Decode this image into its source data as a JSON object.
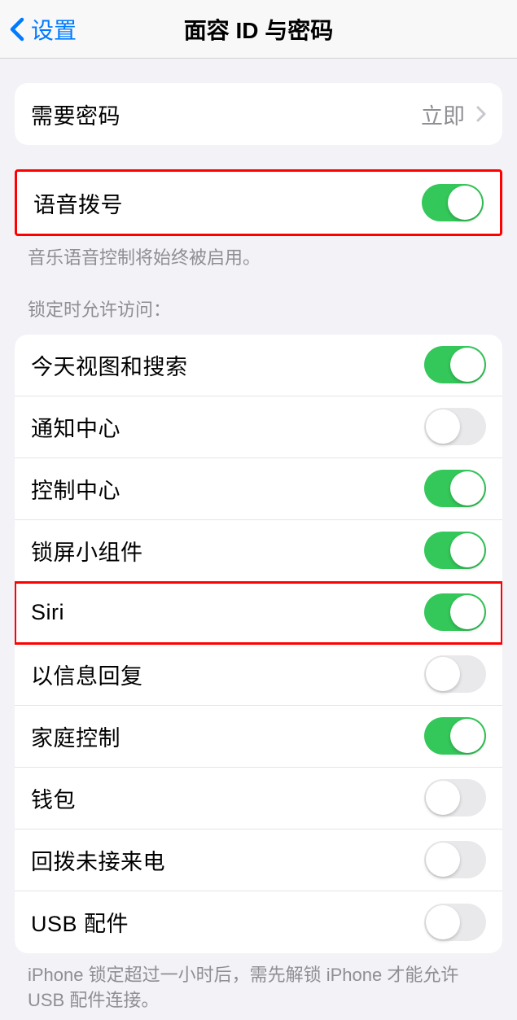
{
  "header": {
    "back_label": "设置",
    "title": "面容 ID 与密码"
  },
  "passcode_row": {
    "label": "需要密码",
    "value": "立即"
  },
  "voice_dial": {
    "label": "语音拨号",
    "enabled": true,
    "footer": "音乐语音控制将始终被启用。"
  },
  "lock_section": {
    "header": "锁定时允许访问：",
    "items": [
      {
        "label": "今天视图和搜索",
        "enabled": true
      },
      {
        "label": "通知中心",
        "enabled": false
      },
      {
        "label": "控制中心",
        "enabled": true
      },
      {
        "label": "锁屏小组件",
        "enabled": true
      },
      {
        "label": "Siri",
        "enabled": true
      },
      {
        "label": "以信息回复",
        "enabled": false
      },
      {
        "label": "家庭控制",
        "enabled": true
      },
      {
        "label": "钱包",
        "enabled": false
      },
      {
        "label": "回拨未接来电",
        "enabled": false
      },
      {
        "label": "USB 配件",
        "enabled": false
      }
    ],
    "footer": "iPhone 锁定超过一小时后，需先解锁 iPhone 才能允许USB 配件连接。"
  },
  "highlights": {
    "voice_dial_group": true,
    "siri_row_index": 4
  }
}
